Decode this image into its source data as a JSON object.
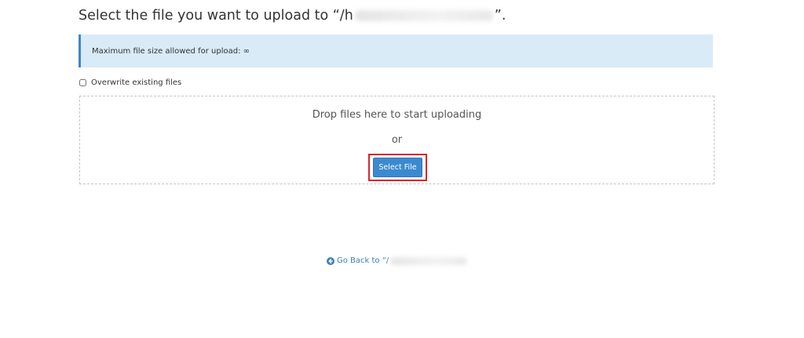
{
  "page": {
    "title_prefix": "Select the file you want to upload to “/h",
    "title_suffix": "”.",
    "max_size_text": "Maximum file size allowed for upload: ∞",
    "overwrite_label": "Overwrite existing files",
    "overwrite_checked": false,
    "drop_text": "Drop files here to start uploading",
    "or_text": "or",
    "select_button_label": "Select File",
    "go_back_text": "Go Back to “/"
  },
  "colors": {
    "info_background": "#d9ebf7",
    "info_border": "#3f86c4",
    "button": "#3b8ad0",
    "highlight": "#d9262c",
    "link": "#3b7fc0"
  },
  "icons": {
    "go_back": "arrow-circle-left-icon"
  }
}
